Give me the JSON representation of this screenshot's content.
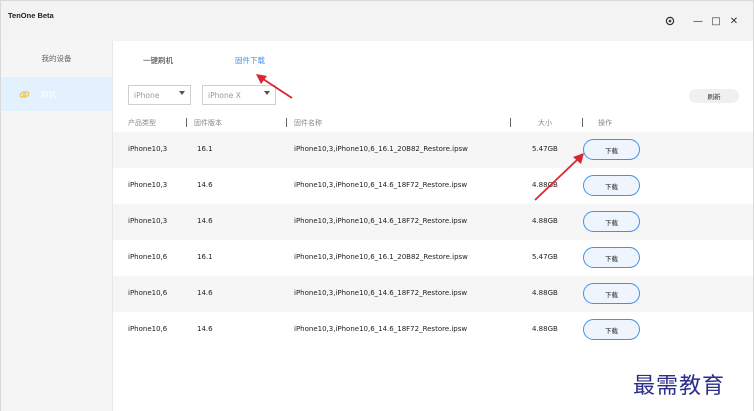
{
  "app": {
    "title": "TenOne Beta"
  },
  "window_controls": {
    "settings_icon": "gear-icon",
    "minimize_glyph": "—",
    "maximize_glyph": "□",
    "close_glyph": "✕"
  },
  "sidebar": {
    "items": [
      {
        "label": "我的设备",
        "active": false
      },
      {
        "label": "刷机",
        "active": true,
        "icon": "link-icon"
      }
    ]
  },
  "tabs": [
    {
      "label": "一键刷机",
      "active": false
    },
    {
      "label": "固件下载",
      "active": true
    }
  ],
  "filters": {
    "product": {
      "value": "iPhone"
    },
    "model": {
      "value": "iPhone X"
    }
  },
  "refresh_label": "刷新",
  "table": {
    "headers": [
      "产品类型",
      "固件版本",
      "固件名称",
      "大小",
      "操作"
    ],
    "rows": [
      {
        "product": "iPhone10,3",
        "version": "16.1",
        "name": "iPhone10,3,iPhone10,6_16.1_20B82_Restore.ipsw",
        "size": "5.47GB",
        "action": "下载"
      },
      {
        "product": "iPhone10,3",
        "version": "14.6",
        "name": "iPhone10,3,iPhone10,6_14.6_18F72_Restore.ipsw",
        "size": "4.88GB",
        "action": "下载"
      },
      {
        "product": "iPhone10,3",
        "version": "14.6",
        "name": "iPhone10,3,iPhone10,6_14.6_18F72_Restore.ipsw",
        "size": "4.88GB",
        "action": "下载"
      },
      {
        "product": "iPhone10,6",
        "version": "16.1",
        "name": "iPhone10,3,iPhone10,6_16.1_20B82_Restore.ipsw",
        "size": "5.47GB",
        "action": "下载"
      },
      {
        "product": "iPhone10,6",
        "version": "14.6",
        "name": "iPhone10,3,iPhone10,6_14.6_18F72_Restore.ipsw",
        "size": "4.88GB",
        "action": "下载"
      },
      {
        "product": "iPhone10,6",
        "version": "14.6",
        "name": "iPhone10,3,iPhone10,6_14.6_18F72_Restore.ipsw",
        "size": "4.88GB",
        "action": "下载"
      }
    ]
  },
  "watermark": "最需教育",
  "colors": {
    "accent": "#4a90e2",
    "annotation_arrow": "#d9272e",
    "sidebar_active": "#e3f0fd",
    "watermark": "#2c2e8a"
  }
}
